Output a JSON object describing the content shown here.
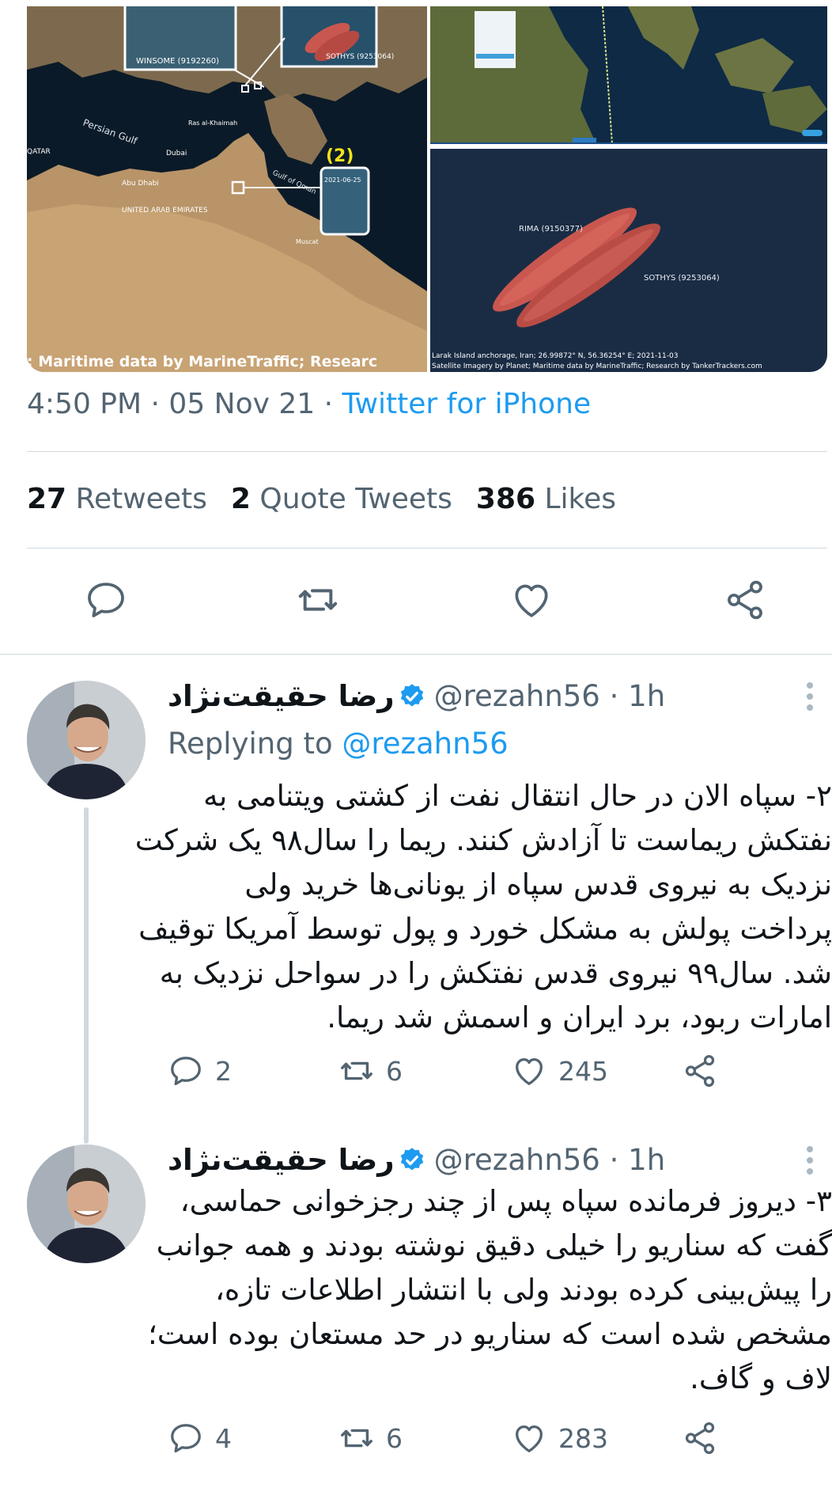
{
  "media": {
    "map": {
      "labels": [
        "Persian Gulf",
        "Dubai",
        "Abu Dhabi",
        "UNITED ARAB EMIRATES",
        "Gulf of Oman",
        "Muscat",
        "Ras al-Khaimah",
        "QATAR"
      ],
      "inset_label_1": "WINSOME (9192260)",
      "inset_label_2": "SOTHYS (9253064)",
      "marker_label": "(2)",
      "inset_date": "2021-06-25",
      "caption": ": Maritime data by MarineTraffic; Researc"
    },
    "satellite": {
      "ship_label_1": "RIMA (9150377)",
      "ship_label_2": "SOTHYS (9253064)",
      "caption_line_1": "Larak Island anchorage, Iran; 26.99872° N, 56.36254° E; 2021-11-03",
      "caption_line_2": "Satellite Imagery by Planet; Maritime data by MarineTraffic; Research by TankerTrackers.com"
    }
  },
  "tweet": {
    "time": "4:50 PM",
    "date": "05 Nov 21",
    "source": "Twitter for iPhone",
    "separator": "·"
  },
  "stats": {
    "retweets_count": "27",
    "retweets_label": "Retweets",
    "quotes_count": "2",
    "quotes_label": "Quote Tweets",
    "likes_count": "386",
    "likes_label": "Likes"
  },
  "replies": [
    {
      "name": "رضا حقیقت‌نژاد",
      "handle": "@rezahn56",
      "time": "1h",
      "replying_prefix": "Replying to",
      "replying_handle": "@rezahn56",
      "lines": [
        "۲- سپاه الان در حال انتقال نفت از کشتی ویتنامی به",
        "نفتکش ریماست تا آزادش کنند. ریما را سال۹۸ یک شرکت",
        "نزدیک به نیروی قدس سپاه از یونانی‌ها خرید ولی",
        "پرداخت پولش به مشکل خورد و پول توسط آمریکا توقیف",
        "شد. سال۹۹ نیروی قدس نفتکش را در سواحل نزدیک به",
        "امارات ربود، برد ایران و اسمش شد ریما."
      ],
      "reply_count": "2",
      "retweet_count": "6",
      "like_count": "245"
    },
    {
      "name": "رضا حقیقت‌نژاد",
      "handle": "@rezahn56",
      "time": "1h",
      "lines": [
        "۳- دیروز فرمانده سپاه پس از چند رجزخوانی حماسی،",
        "گفت که سناریو را خیلی دقیق نوشته بودند و همه جوانب",
        "را پیش‌بینی کرده بودند ولی با انتشار اطلاعات تازه،",
        "مشخص شده است که سناریو در حد مستعان بوده است؛",
        "لاف و گاف."
      ],
      "reply_count": "4",
      "retweet_count": "6",
      "like_count": "283"
    }
  ],
  "colors": {
    "link": "#1d9bf0",
    "secondary": "#536471",
    "text": "#0f1419",
    "divider": "#cfd9de",
    "verified": "#1d9bf0"
  }
}
